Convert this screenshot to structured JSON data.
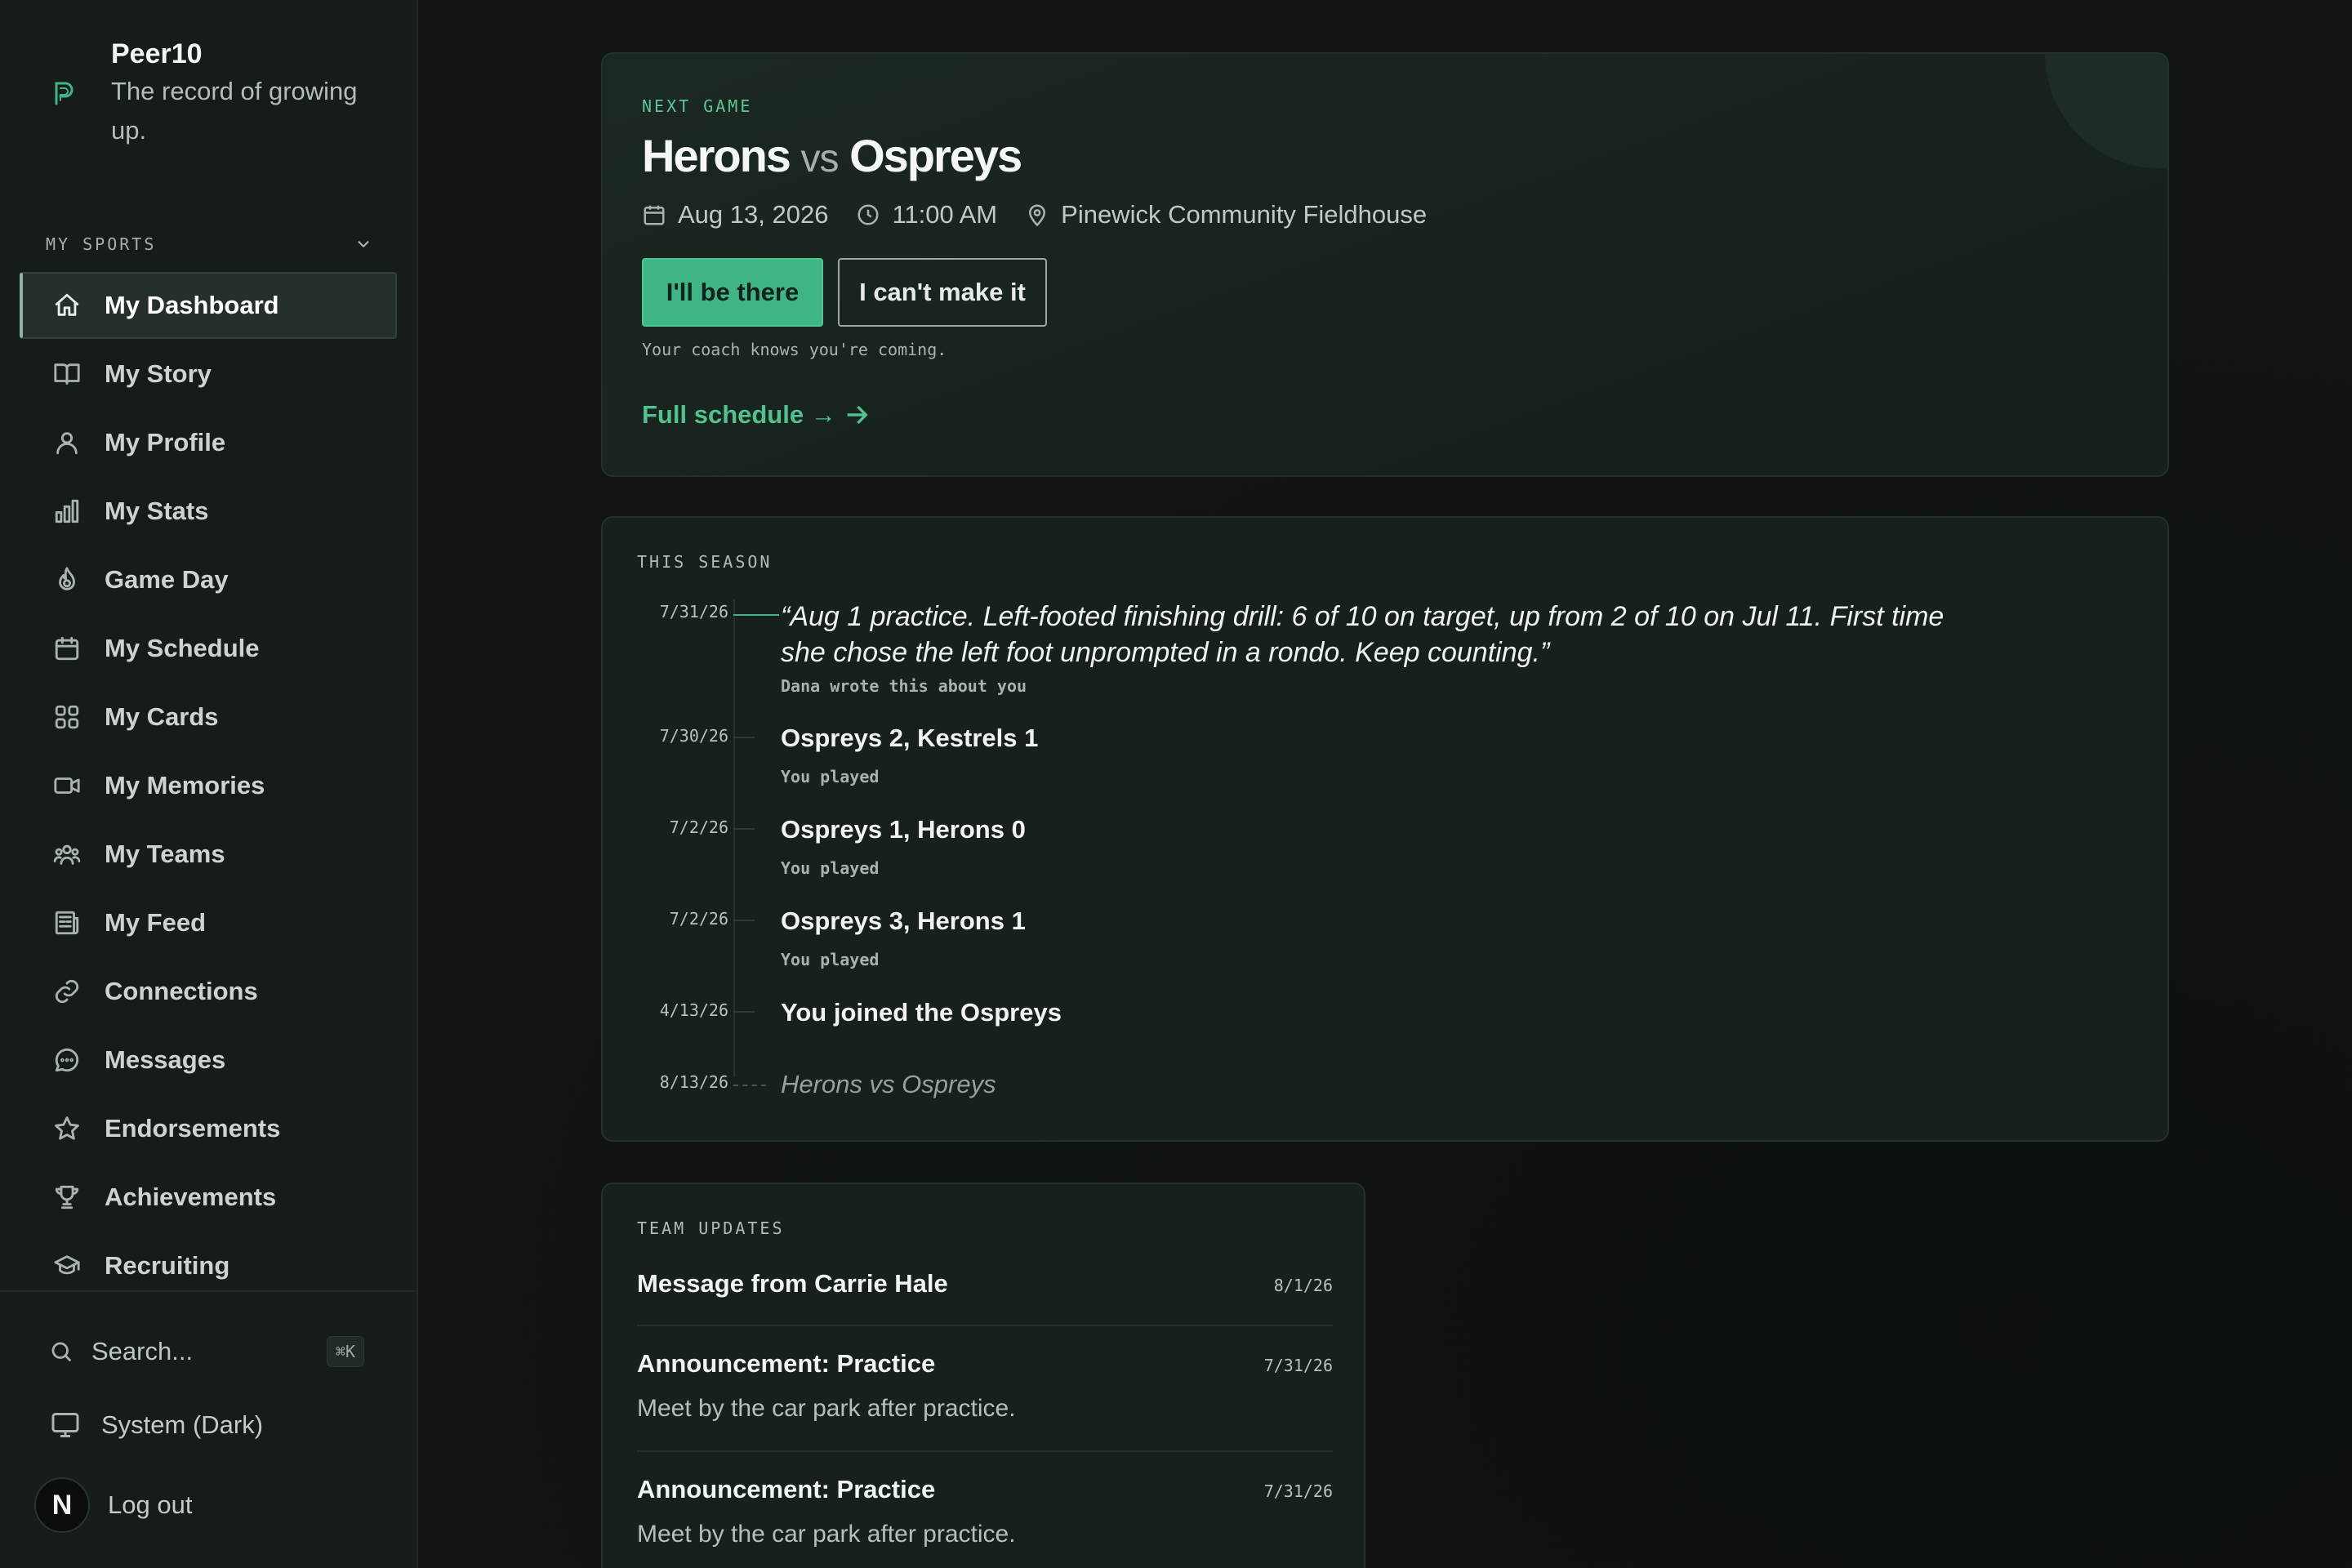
{
  "brand": {
    "name": "Peer10",
    "tagline": "The record of growing up."
  },
  "sidebar": {
    "section_label": "MY SPORTS",
    "items": [
      {
        "label": "My Dashboard",
        "icon": "home-icon",
        "active": true
      },
      {
        "label": "My Story",
        "icon": "book-icon"
      },
      {
        "label": "My Profile",
        "icon": "user-icon"
      },
      {
        "label": "My Stats",
        "icon": "bar-chart-icon"
      },
      {
        "label": "Game Day",
        "icon": "flame-icon"
      },
      {
        "label": "My Schedule",
        "icon": "calendar-icon"
      },
      {
        "label": "My Cards",
        "icon": "grid-icon"
      },
      {
        "label": "My Memories",
        "icon": "video-icon"
      },
      {
        "label": "My Teams",
        "icon": "users-icon"
      },
      {
        "label": "My Feed",
        "icon": "newspaper-icon"
      },
      {
        "label": "Connections",
        "icon": "link-icon"
      },
      {
        "label": "Messages",
        "icon": "message-icon"
      },
      {
        "label": "Endorsements",
        "icon": "star-icon"
      },
      {
        "label": "Achievements",
        "icon": "trophy-icon"
      },
      {
        "label": "Recruiting",
        "icon": "graduation-cap-icon"
      }
    ],
    "search": {
      "label": "Search...",
      "shortcut": "⌘K"
    },
    "theme": {
      "label": "System (Dark)"
    },
    "user": {
      "initial": "N",
      "logout_label": "Log out"
    }
  },
  "next_game": {
    "eyebrow": "NEXT GAME",
    "home": "Herons",
    "vs": "vs",
    "away": "Ospreys",
    "date": "Aug 13, 2026",
    "time": "11:00 AM",
    "location": "Pinewick Community Fieldhouse",
    "attend_label": "I'll be there",
    "decline_label": "I can't make it",
    "note": "Your coach knows you're coming.",
    "schedule_link": "Full schedule →"
  },
  "season": {
    "eyebrow": "THIS SEASON",
    "quote": {
      "date": "7/31/26",
      "text": "“Aug 1 practice. Left-footed finishing drill: 6 of 10 on target, up from 2 of 10 on Jul 11. First time she chose the left foot unprompted in a rondo. Keep counting.”",
      "attribution": "Dana wrote this about you"
    },
    "events": [
      {
        "date": "7/30/26",
        "title": "Ospreys 2, Kestrels 1",
        "sub": "You played"
      },
      {
        "date": "7/2/26",
        "title": "Ospreys 1, Herons 0",
        "sub": "You played"
      },
      {
        "date": "7/2/26",
        "title": "Ospreys 3, Herons 1",
        "sub": "You played"
      },
      {
        "date": "4/13/26",
        "title": "You joined the Ospreys",
        "sub": ""
      }
    ],
    "upcoming": {
      "date": "8/13/26",
      "title": "Herons vs Ospreys"
    }
  },
  "team_updates": {
    "eyebrow": "TEAM UPDATES",
    "items": [
      {
        "title": "Message from Carrie Hale",
        "date": "8/1/26",
        "body": ""
      },
      {
        "title": "Announcement: Practice",
        "date": "7/31/26",
        "body": "Meet by the car park after practice."
      },
      {
        "title": "Announcement: Practice",
        "date": "7/31/26",
        "body": "Meet by the car park after practice."
      }
    ]
  },
  "colors": {
    "accent": "#3fb585",
    "link": "#52c18d",
    "background": "#0f1412",
    "sidebar": "#161c19"
  }
}
